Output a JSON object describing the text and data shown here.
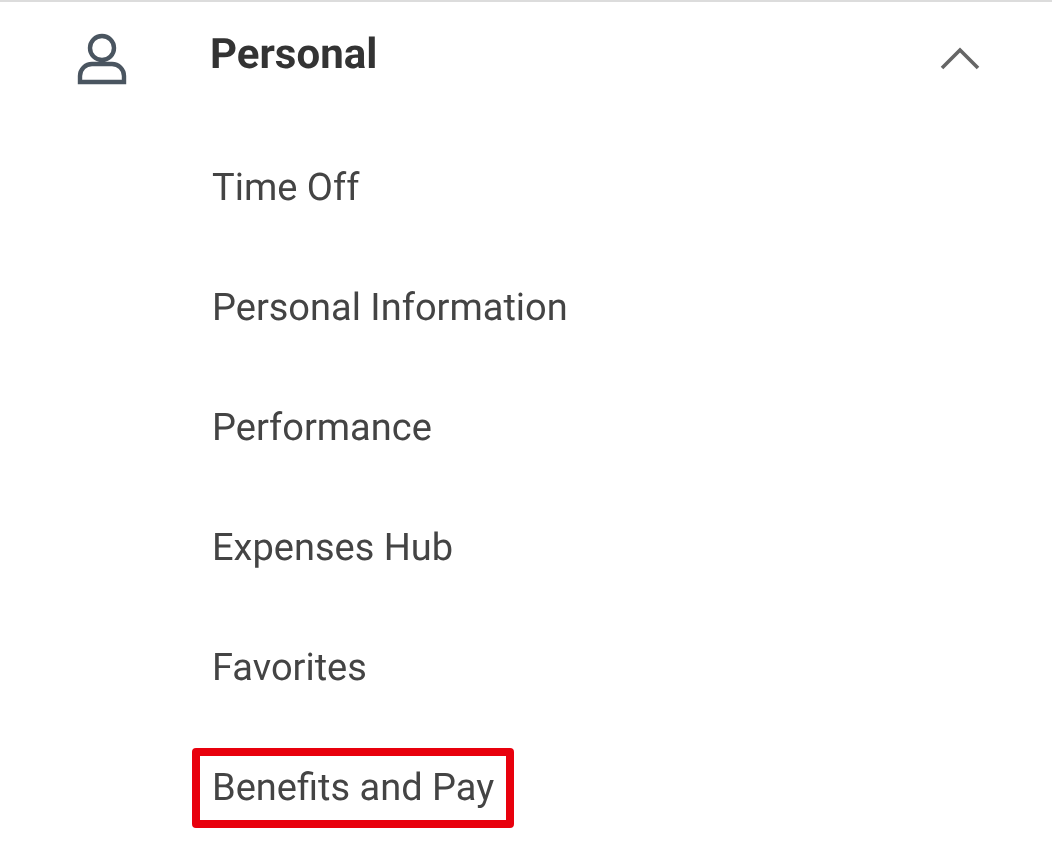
{
  "section": {
    "title": "Personal",
    "expanded": true
  },
  "items": [
    {
      "label": "Time Off",
      "highlighted": false
    },
    {
      "label": "Personal Information",
      "highlighted": false
    },
    {
      "label": "Performance",
      "highlighted": false
    },
    {
      "label": "Expenses Hub",
      "highlighted": false
    },
    {
      "label": "Favorites",
      "highlighted": false
    },
    {
      "label": "Benefits and Pay",
      "highlighted": true
    }
  ]
}
